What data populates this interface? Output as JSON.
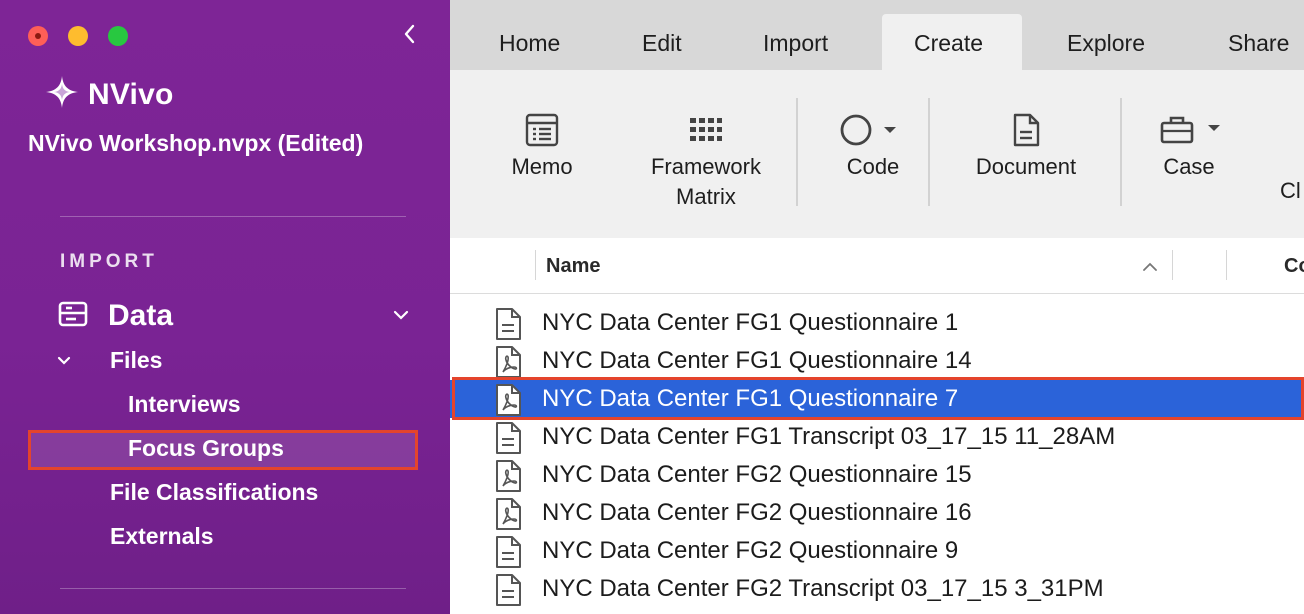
{
  "sidebar": {
    "brand": "NVivo",
    "project": "NVivo Workshop.nvpx (Edited)",
    "section": "IMPORT",
    "data_label": "Data",
    "files_label": "Files",
    "interviews_label": "Interviews",
    "focus_groups_label": "Focus Groups",
    "file_classifications_label": "File Classifications",
    "externals_label": "Externals"
  },
  "tabs": [
    "Home",
    "Edit",
    "Import",
    "Create",
    "Explore",
    "Share"
  ],
  "active_tab": "Create",
  "toolbar": {
    "memo": "Memo",
    "framework_1": "Framework",
    "framework_2": "Matrix",
    "code": "Code",
    "document": "Document",
    "case": "Case",
    "cut_label": "Cl"
  },
  "list": {
    "header_name": "Name",
    "header_col2": "Co",
    "rows": [
      {
        "name": "NYC Data Center FG1 Questionnaire 1",
        "icon": "text-doc-icon"
      },
      {
        "name": "NYC Data Center FG1 Questionnaire 14",
        "icon": "pdf-doc-icon"
      },
      {
        "name": "NYC Data Center FG1 Questionnaire 7",
        "icon": "pdf-doc-icon",
        "selected": true
      },
      {
        "name": "NYC Data Center FG1 Transcript 03_17_15 11_28AM",
        "icon": "text-doc-icon"
      },
      {
        "name": "NYC Data Center FG2 Questionnaire 15",
        "icon": "pdf-doc-icon"
      },
      {
        "name": "NYC Data Center FG2 Questionnaire 16",
        "icon": "pdf-doc-icon"
      },
      {
        "name": "NYC Data Center FG2 Questionnaire 9",
        "icon": "text-doc-icon"
      },
      {
        "name": "NYC Data Center FG2 Transcript 03_17_15 3_31PM",
        "icon": "text-doc-icon"
      }
    ]
  },
  "colors": {
    "sidebar": "#7e2596",
    "selection": "#2b63d9",
    "highlight_outline": "#e4442c"
  }
}
